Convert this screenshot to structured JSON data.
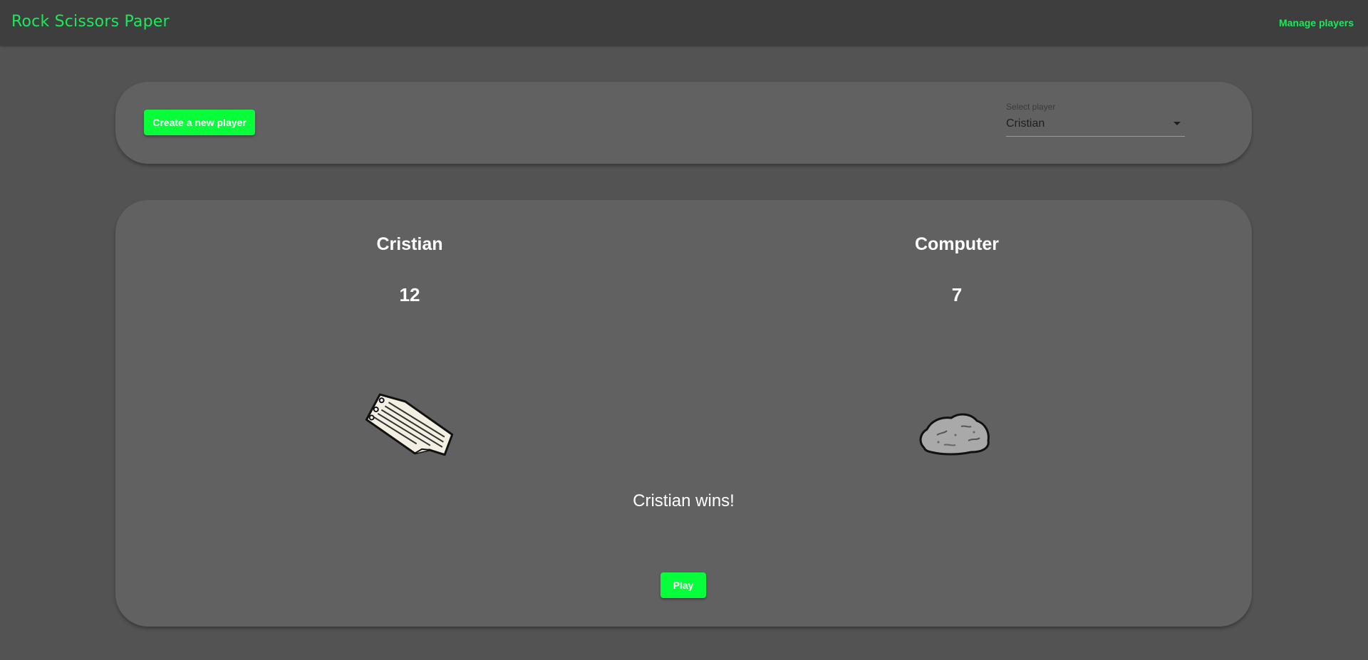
{
  "header": {
    "app_title": "Rock Scissors Paper",
    "manage_players_label": "Manage players"
  },
  "controls": {
    "create_player_label": "Create a new player",
    "select_label": "Select player",
    "selected_player": "Cristian"
  },
  "game": {
    "player": {
      "name": "Cristian",
      "score": "12",
      "choice": "paper"
    },
    "opponent": {
      "name": "Computer",
      "score": "7",
      "choice": "rock"
    },
    "result": "Cristian wins!",
    "play_label": "Play"
  },
  "colors": {
    "accent": "#1ee85a",
    "button": "#06ff3a",
    "background": "#535353",
    "card": "#616161",
    "topbar": "#3e3e3e"
  }
}
